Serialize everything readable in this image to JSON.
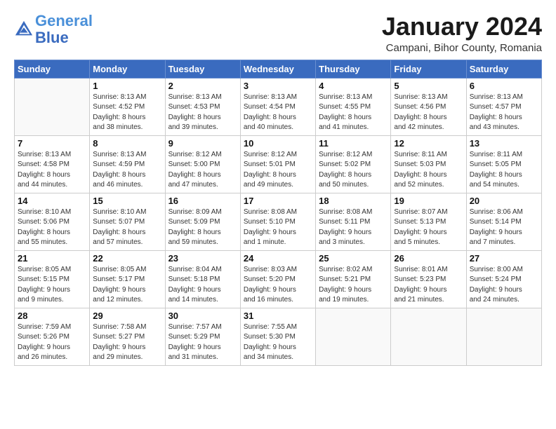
{
  "header": {
    "logo_line1": "General",
    "logo_line2": "Blue",
    "month": "January 2024",
    "location": "Campani, Bihor County, Romania"
  },
  "days_of_week": [
    "Sunday",
    "Monday",
    "Tuesday",
    "Wednesday",
    "Thursday",
    "Friday",
    "Saturday"
  ],
  "weeks": [
    [
      {
        "day": "",
        "info": ""
      },
      {
        "day": "1",
        "info": "Sunrise: 8:13 AM\nSunset: 4:52 PM\nDaylight: 8 hours\nand 38 minutes."
      },
      {
        "day": "2",
        "info": "Sunrise: 8:13 AM\nSunset: 4:53 PM\nDaylight: 8 hours\nand 39 minutes."
      },
      {
        "day": "3",
        "info": "Sunrise: 8:13 AM\nSunset: 4:54 PM\nDaylight: 8 hours\nand 40 minutes."
      },
      {
        "day": "4",
        "info": "Sunrise: 8:13 AM\nSunset: 4:55 PM\nDaylight: 8 hours\nand 41 minutes."
      },
      {
        "day": "5",
        "info": "Sunrise: 8:13 AM\nSunset: 4:56 PM\nDaylight: 8 hours\nand 42 minutes."
      },
      {
        "day": "6",
        "info": "Sunrise: 8:13 AM\nSunset: 4:57 PM\nDaylight: 8 hours\nand 43 minutes."
      }
    ],
    [
      {
        "day": "7",
        "info": "Sunrise: 8:13 AM\nSunset: 4:58 PM\nDaylight: 8 hours\nand 44 minutes."
      },
      {
        "day": "8",
        "info": "Sunrise: 8:13 AM\nSunset: 4:59 PM\nDaylight: 8 hours\nand 46 minutes."
      },
      {
        "day": "9",
        "info": "Sunrise: 8:12 AM\nSunset: 5:00 PM\nDaylight: 8 hours\nand 47 minutes."
      },
      {
        "day": "10",
        "info": "Sunrise: 8:12 AM\nSunset: 5:01 PM\nDaylight: 8 hours\nand 49 minutes."
      },
      {
        "day": "11",
        "info": "Sunrise: 8:12 AM\nSunset: 5:02 PM\nDaylight: 8 hours\nand 50 minutes."
      },
      {
        "day": "12",
        "info": "Sunrise: 8:11 AM\nSunset: 5:03 PM\nDaylight: 8 hours\nand 52 minutes."
      },
      {
        "day": "13",
        "info": "Sunrise: 8:11 AM\nSunset: 5:05 PM\nDaylight: 8 hours\nand 54 minutes."
      }
    ],
    [
      {
        "day": "14",
        "info": "Sunrise: 8:10 AM\nSunset: 5:06 PM\nDaylight: 8 hours\nand 55 minutes."
      },
      {
        "day": "15",
        "info": "Sunrise: 8:10 AM\nSunset: 5:07 PM\nDaylight: 8 hours\nand 57 minutes."
      },
      {
        "day": "16",
        "info": "Sunrise: 8:09 AM\nSunset: 5:09 PM\nDaylight: 8 hours\nand 59 minutes."
      },
      {
        "day": "17",
        "info": "Sunrise: 8:08 AM\nSunset: 5:10 PM\nDaylight: 9 hours\nand 1 minute."
      },
      {
        "day": "18",
        "info": "Sunrise: 8:08 AM\nSunset: 5:11 PM\nDaylight: 9 hours\nand 3 minutes."
      },
      {
        "day": "19",
        "info": "Sunrise: 8:07 AM\nSunset: 5:13 PM\nDaylight: 9 hours\nand 5 minutes."
      },
      {
        "day": "20",
        "info": "Sunrise: 8:06 AM\nSunset: 5:14 PM\nDaylight: 9 hours\nand 7 minutes."
      }
    ],
    [
      {
        "day": "21",
        "info": "Sunrise: 8:05 AM\nSunset: 5:15 PM\nDaylight: 9 hours\nand 9 minutes."
      },
      {
        "day": "22",
        "info": "Sunrise: 8:05 AM\nSunset: 5:17 PM\nDaylight: 9 hours\nand 12 minutes."
      },
      {
        "day": "23",
        "info": "Sunrise: 8:04 AM\nSunset: 5:18 PM\nDaylight: 9 hours\nand 14 minutes."
      },
      {
        "day": "24",
        "info": "Sunrise: 8:03 AM\nSunset: 5:20 PM\nDaylight: 9 hours\nand 16 minutes."
      },
      {
        "day": "25",
        "info": "Sunrise: 8:02 AM\nSunset: 5:21 PM\nDaylight: 9 hours\nand 19 minutes."
      },
      {
        "day": "26",
        "info": "Sunrise: 8:01 AM\nSunset: 5:23 PM\nDaylight: 9 hours\nand 21 minutes."
      },
      {
        "day": "27",
        "info": "Sunrise: 8:00 AM\nSunset: 5:24 PM\nDaylight: 9 hours\nand 24 minutes."
      }
    ],
    [
      {
        "day": "28",
        "info": "Sunrise: 7:59 AM\nSunset: 5:26 PM\nDaylight: 9 hours\nand 26 minutes."
      },
      {
        "day": "29",
        "info": "Sunrise: 7:58 AM\nSunset: 5:27 PM\nDaylight: 9 hours\nand 29 minutes."
      },
      {
        "day": "30",
        "info": "Sunrise: 7:57 AM\nSunset: 5:29 PM\nDaylight: 9 hours\nand 31 minutes."
      },
      {
        "day": "31",
        "info": "Sunrise: 7:55 AM\nSunset: 5:30 PM\nDaylight: 9 hours\nand 34 minutes."
      },
      {
        "day": "",
        "info": ""
      },
      {
        "day": "",
        "info": ""
      },
      {
        "day": "",
        "info": ""
      }
    ]
  ]
}
